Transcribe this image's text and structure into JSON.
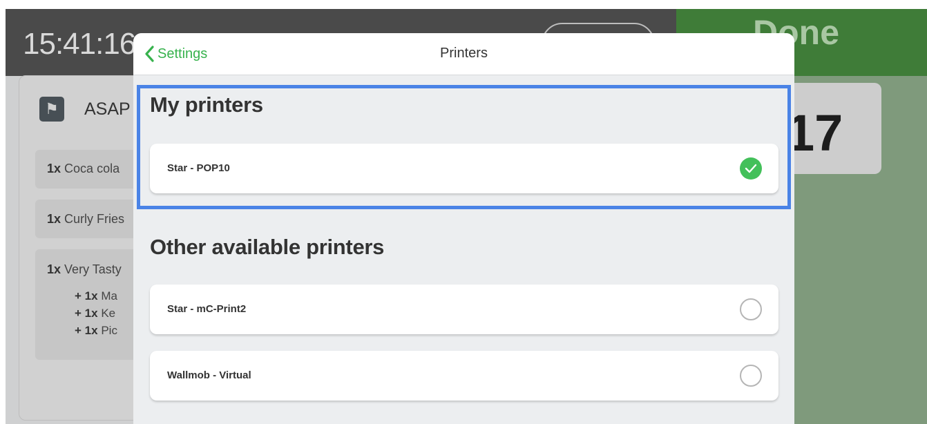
{
  "background": {
    "clock": "15:41:16",
    "done_label": "Done",
    "ticket_number": "17",
    "order_type": "ASAP",
    "items": [
      {
        "qty": "1x",
        "name": "Coca cola"
      },
      {
        "qty": "1x",
        "name": "Curly Fries"
      },
      {
        "qty": "1x",
        "name": "Very Tasty"
      }
    ],
    "modifiers": [
      {
        "qty": "1x",
        "name": "Ma"
      },
      {
        "qty": "1x",
        "name": "Ke"
      },
      {
        "qty": "1x",
        "name": "Pic"
      }
    ]
  },
  "modal": {
    "back_label": "Settings",
    "title": "Printers",
    "my_printers_heading": "My printers",
    "other_printers_heading": "Other available printers",
    "my_printers": [
      {
        "name": "Star - POP10",
        "selected": true
      }
    ],
    "other_printers": [
      {
        "name": "Star - mC-Print2",
        "selected": false
      },
      {
        "name": "Wallmob - Virtual",
        "selected": false
      }
    ]
  },
  "colors": {
    "accent_green": "#43c05a",
    "back_link_green": "#37b24d",
    "highlight_blue": "#4a83e6",
    "done_bar": "#3f7c38"
  },
  "icons": {
    "back": "chevron-left-icon",
    "selected": "check-circle-icon",
    "unselected": "radio-empty-icon",
    "order_type": "fork-knife-icon"
  }
}
